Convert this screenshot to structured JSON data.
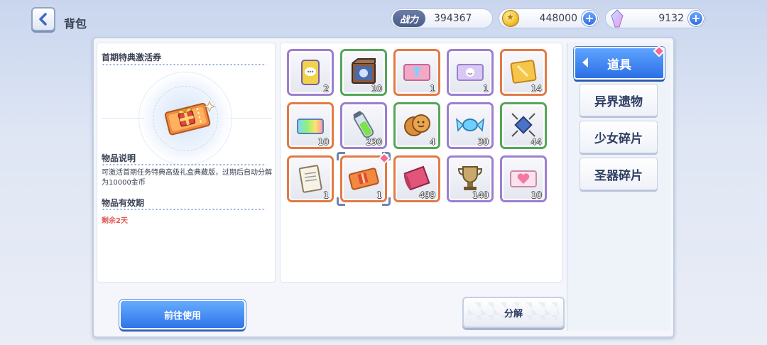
{
  "header": {
    "title": "背包",
    "power_label": "战力",
    "power_value": "394367",
    "gold_value": "448000",
    "gem_value": "9132"
  },
  "detail": {
    "item_name": "首期特典激活券",
    "desc_title": "物品说明",
    "desc_text": "可激活首期任务特典高级礼盒典藏版，过期后自动分解为10000金币",
    "expire_title": "物品有效期",
    "expire_text": "剩余2天"
  },
  "inventory": [
    {
      "icon": "can-icon",
      "count": "2",
      "rarity": "purple"
    },
    {
      "icon": "crate-icon",
      "count": "10",
      "rarity": "green"
    },
    {
      "icon": "outfit-ticket-icon",
      "count": "1",
      "rarity": "orange"
    },
    {
      "icon": "smile-ticket-icon",
      "count": "1",
      "rarity": "purple"
    },
    {
      "icon": "gold-card-icon",
      "count": "14",
      "rarity": "orange"
    },
    {
      "icon": "rainbow-ticket-icon",
      "count": "10",
      "rarity": "orange"
    },
    {
      "icon": "green-potion-icon",
      "count": "230",
      "rarity": "purple"
    },
    {
      "icon": "cookie-icon",
      "count": "4",
      "rarity": "green"
    },
    {
      "icon": "candy-icon",
      "count": "30",
      "rarity": "purple"
    },
    {
      "icon": "gadget-icon",
      "count": "44",
      "rarity": "green"
    },
    {
      "icon": "clipboard-icon",
      "count": "1",
      "rarity": "orange"
    },
    {
      "icon": "gift-ticket-icon",
      "count": "1",
      "rarity": "orange"
    },
    {
      "icon": "scroll-icon",
      "count": "499",
      "rarity": "orange"
    },
    {
      "icon": "trophy-icon",
      "count": "140",
      "rarity": "purple"
    },
    {
      "icon": "heart-ticket-icon",
      "count": "10",
      "rarity": "purple"
    }
  ],
  "categories": [
    {
      "label": "道具",
      "active": true
    },
    {
      "label": "异界遗物",
      "active": false
    },
    {
      "label": "少女碎片",
      "active": false
    },
    {
      "label": "圣器碎片",
      "active": false
    }
  ],
  "actions": {
    "use_label": "前往使用",
    "decompose_label": "分解"
  },
  "colors": {
    "accent_blue": "#2f74e8",
    "expire_red": "#e15a55",
    "rarity_purple": "#9b7fd0",
    "rarity_green": "#56a55a",
    "rarity_orange": "#e27a45"
  }
}
